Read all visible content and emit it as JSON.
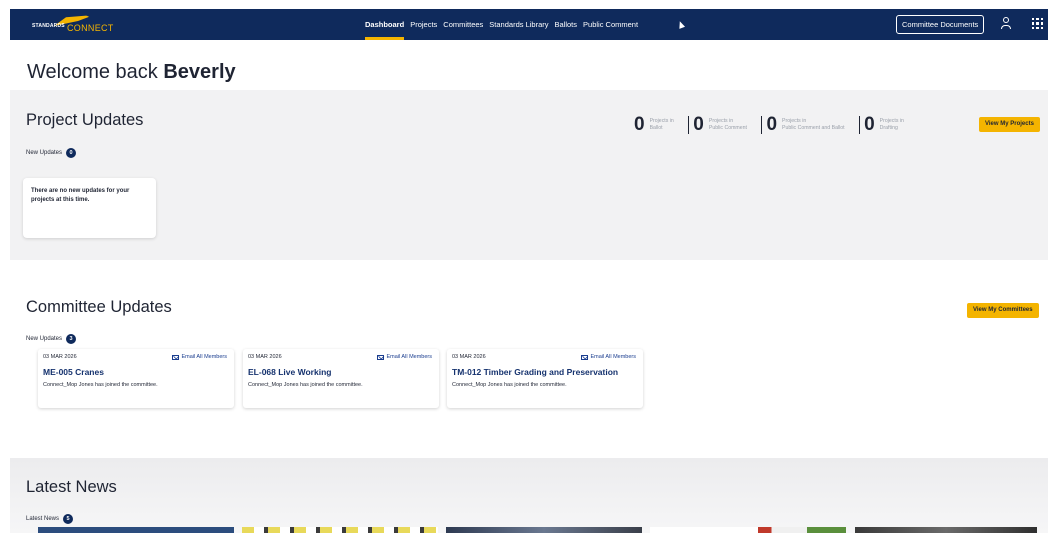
{
  "header": {
    "logo_small": "STANDARDS",
    "logo_big": "CONNECT",
    "nav": [
      {
        "label": "Dashboard",
        "active": true
      },
      {
        "label": "Projects",
        "active": false
      },
      {
        "label": "Committees",
        "active": false
      },
      {
        "label": "Standards Library",
        "active": false
      },
      {
        "label": "Ballots",
        "active": false
      },
      {
        "label": "Public Comment",
        "active": false
      }
    ],
    "committee_docs_label": "Committee Documents",
    "icons": [
      "user-icon",
      "apps-grid-icon"
    ],
    "colors": {
      "nav_bg": "#0f2a5c",
      "accent": "#f4b400"
    }
  },
  "welcome": {
    "prefix": "Welcome back",
    "name": "Beverly"
  },
  "project_updates": {
    "title": "Project Updates",
    "new_updates_label": "New Updates",
    "new_updates_count": "0",
    "empty_message": "There are no new updates for your projects at this time.",
    "stats": [
      {
        "count": "0",
        "label_line1": "Projects in",
        "label_line2": "Ballot"
      },
      {
        "count": "0",
        "label_line1": "Projects in",
        "label_line2": "Public Comment"
      },
      {
        "count": "0",
        "label_line1": "Projects in",
        "label_line2": "Public Comment and Ballot"
      },
      {
        "count": "0",
        "label_line1": "Projects in",
        "label_line2": "Drafting"
      }
    ],
    "view_button": "View My Projects"
  },
  "committee_updates": {
    "title": "Committee Updates",
    "new_updates_label": "New Updates",
    "new_updates_count": "3",
    "view_button": "View My Committees",
    "cards": [
      {
        "date": "03 MAR 2026",
        "email_label": "Email All Members",
        "title": "ME-005 Cranes",
        "description": "Connect_Mop Jones has joined the committee."
      },
      {
        "date": "03 MAR 2026",
        "email_label": "Email All Members",
        "title": "EL-068 Live Working",
        "description": "Connect_Mop Jones has joined the committee."
      },
      {
        "date": "03 MAR 2026",
        "email_label": "Email All Members",
        "title": "TM-012 Timber Grading and Preservation",
        "description": "Connect_Mop Jones has joined the committee."
      }
    ]
  },
  "latest_news": {
    "title": "Latest News",
    "label": "Latest News",
    "count": "5"
  }
}
